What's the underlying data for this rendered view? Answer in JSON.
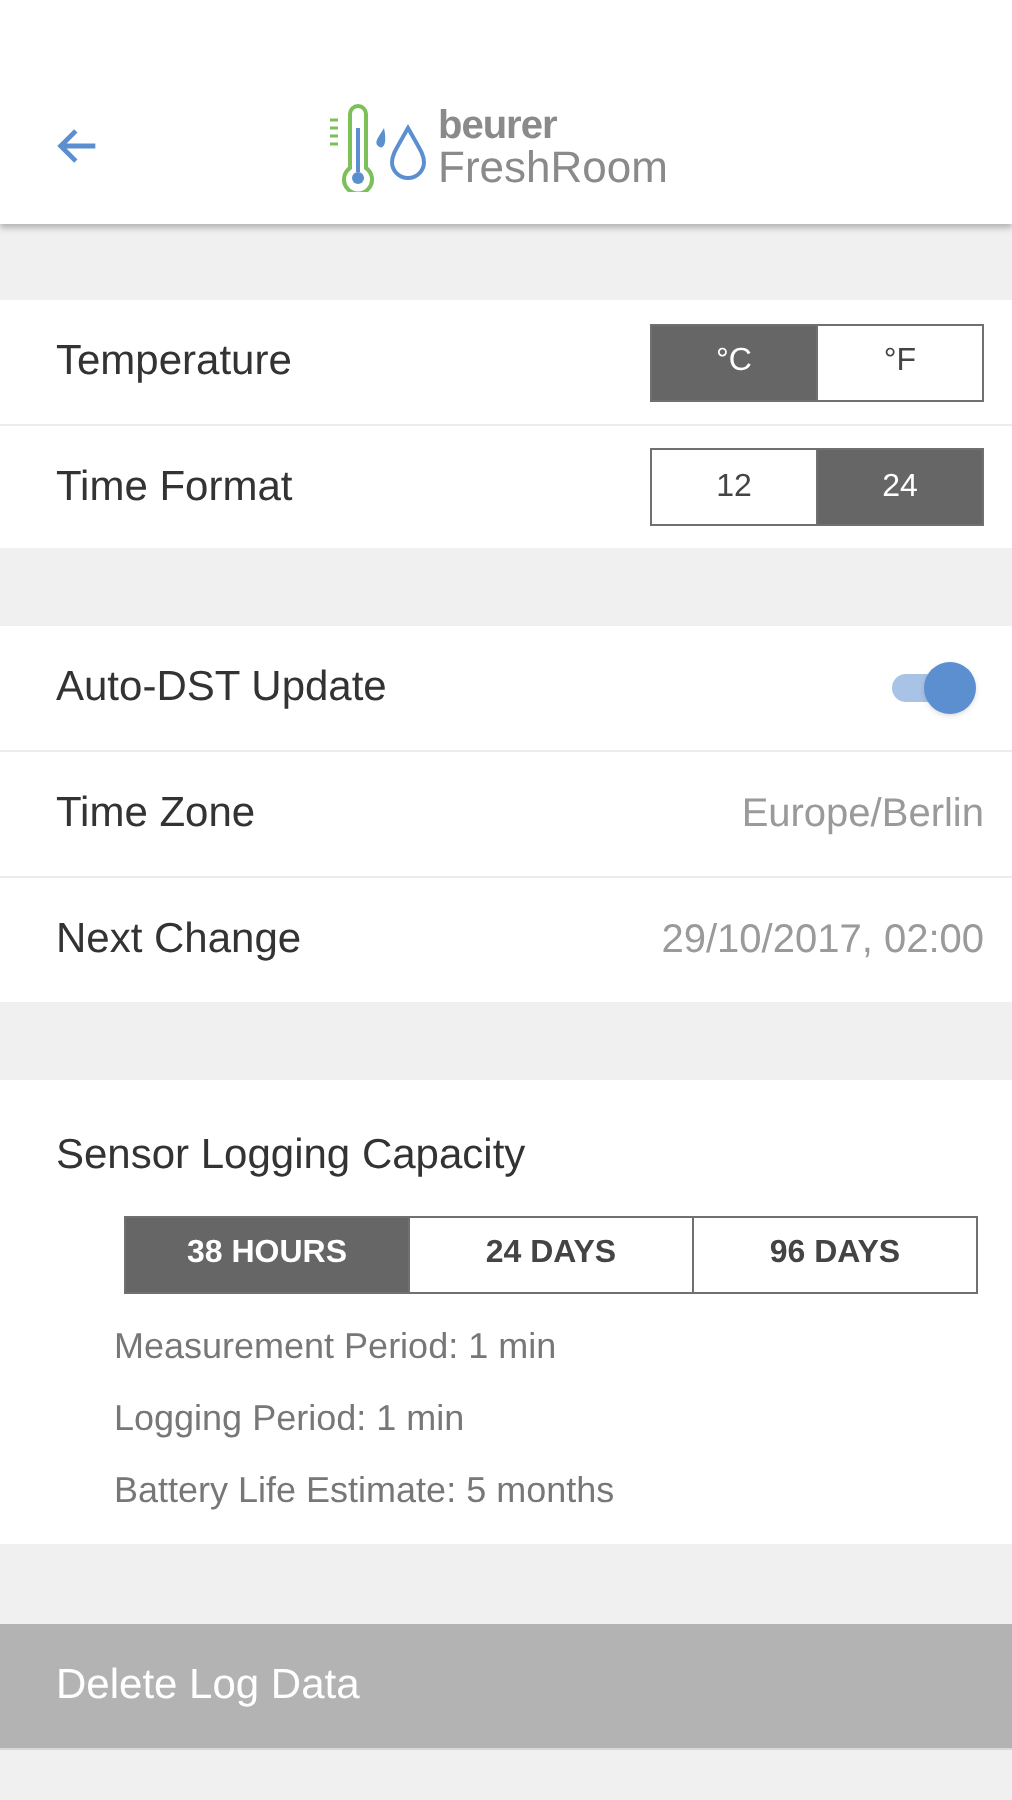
{
  "header": {
    "brand": "beurer",
    "product": "FreshRoom"
  },
  "units": [
    {
      "label": "Temperature",
      "options": [
        {
          "label": "°C",
          "selected": true
        },
        {
          "label": "°F",
          "selected": false
        }
      ]
    },
    {
      "label": "Time Format",
      "options": [
        {
          "label": "12",
          "selected": false
        },
        {
          "label": "24",
          "selected": true
        }
      ]
    }
  ],
  "dst": {
    "label": "Auto-DST Update",
    "on": true
  },
  "info_rows": [
    {
      "label": "Time Zone",
      "value": "Europe/Berlin"
    },
    {
      "label": "Next Change",
      "value": "29/10/2017, 02:00"
    }
  ],
  "logging": {
    "title": "Sensor Logging Capacity",
    "options": [
      {
        "label": "38 HOURS",
        "selected": true
      },
      {
        "label": "24 DAYS",
        "selected": false
      },
      {
        "label": "96 DAYS",
        "selected": false
      }
    ],
    "details": [
      "Measurement Period: 1 min",
      "Logging Period: 1 min",
      "Battery Life Estimate: 5 months"
    ]
  },
  "delete_button": "Delete Log Data"
}
